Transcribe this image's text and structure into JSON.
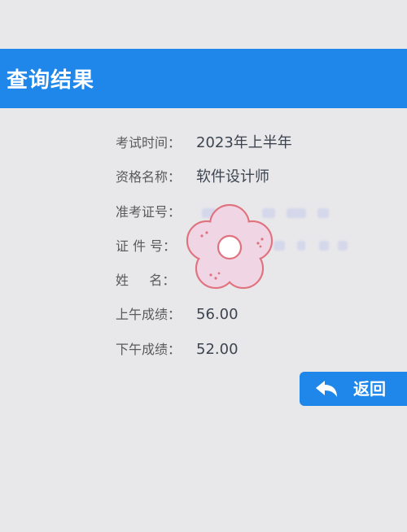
{
  "header": {
    "title": "查询结果"
  },
  "fields": [
    {
      "label": "考试时间：",
      "value": "2023年上半年"
    },
    {
      "label": "资格名称：",
      "value": "软件设计师"
    },
    {
      "label": "准考证号：",
      "value": ""
    },
    {
      "label": "证 件 号：",
      "value": ""
    },
    {
      "label": "姓     名：",
      "value": ""
    },
    {
      "label": "上午成绩：",
      "value": "56.00"
    },
    {
      "label": "下午成绩：",
      "value": "52.00"
    }
  ],
  "back_button": {
    "label": "返回",
    "icon": "back-arrow-icon"
  },
  "colors": {
    "accent": "#1f86ea",
    "background": "#e8e8ea",
    "sticker": "#f0d6e4"
  }
}
